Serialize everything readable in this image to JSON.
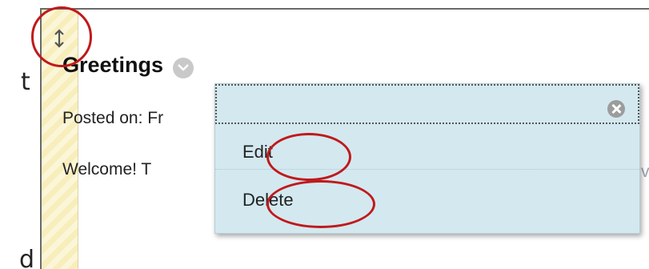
{
  "slide_fragments": {
    "top_letter": "t",
    "bottom_letter": "d"
  },
  "item": {
    "title": "Greetings",
    "posted": "Posted on: Fr",
    "body": "Welcome!  T",
    "trailing": "v"
  },
  "menu": {
    "items": [
      {
        "label": "Edit"
      },
      {
        "label": "Delete"
      }
    ]
  },
  "icons": {
    "drag_handle": "vertical-resize-arrows",
    "chevron": "chevron-down",
    "close": "close-x-circle"
  },
  "colors": {
    "annotation": "#c0191c",
    "menu_background": "#d3e9ef",
    "drag_strip": "#f7eebc"
  }
}
